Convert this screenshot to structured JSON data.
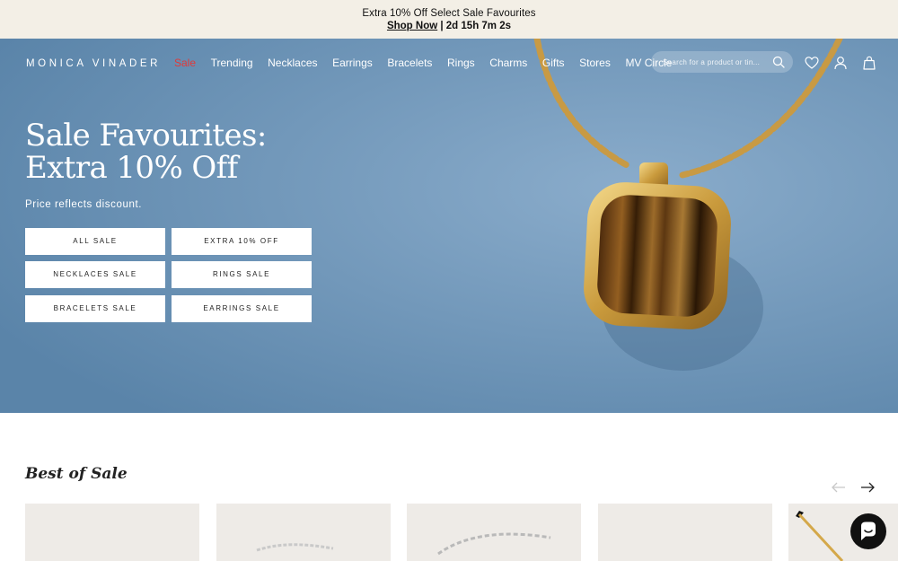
{
  "promo": {
    "headline": "Extra 10% Off Select Sale Favourites",
    "link": "Shop Now",
    "countdown": "| 2d 15h 7m 2s"
  },
  "brand": {
    "logo": "MONICA VINADER"
  },
  "nav": {
    "items": [
      {
        "label": "Sale",
        "color": "#e03a3a"
      },
      {
        "label": "Trending"
      },
      {
        "label": "Necklaces"
      },
      {
        "label": "Earrings"
      },
      {
        "label": "Bracelets"
      },
      {
        "label": "Rings"
      },
      {
        "label": "Charms"
      },
      {
        "label": "Gifts"
      },
      {
        "label": "Stores"
      },
      {
        "label": "MV Circle"
      }
    ],
    "search_placeholder": "Search for a product or tin...",
    "icons": [
      "search-icon",
      "heart-icon",
      "account-icon",
      "bag-icon"
    ]
  },
  "hero": {
    "title": "Sale Favourites: Extra 10% Off",
    "subtitle": "Price reflects discount.",
    "buttons": [
      "ALL SALE",
      "EXTRA 10% OFF",
      "NECKLACES SALE",
      "RINGS SALE",
      "BRACELETS SALE",
      "EARRINGS SALE"
    ],
    "background_color": "#6a94b8"
  },
  "section": {
    "title": "Best of Sale",
    "arrows": [
      "arrow-left-icon",
      "arrow-right-icon"
    ]
  },
  "chat": {
    "icon": "chat-icon"
  }
}
